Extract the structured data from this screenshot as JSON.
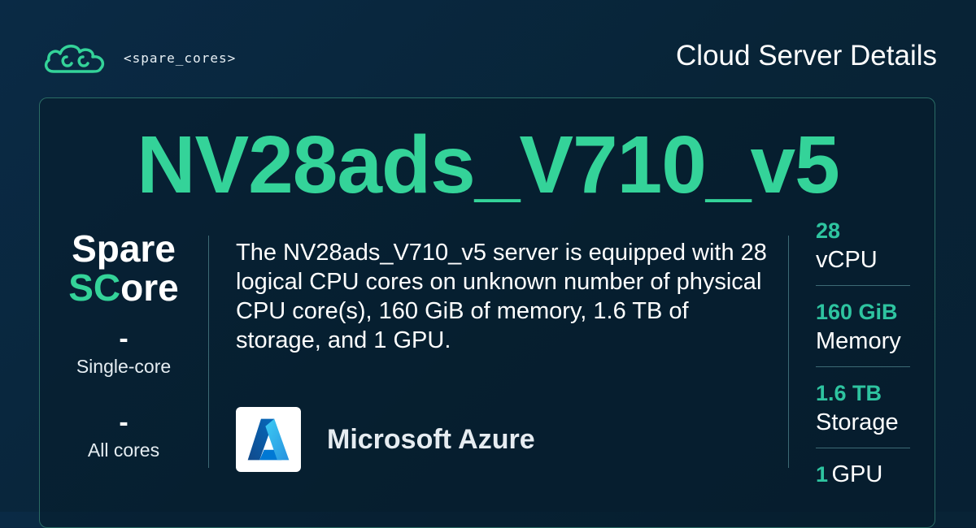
{
  "brand": {
    "name": "<spare_cores>"
  },
  "header": {
    "page_label": "Cloud Server Details"
  },
  "server": {
    "name": "NV28ads_V710_v5"
  },
  "score": {
    "title_line1": "Spare",
    "title_accent": "SC",
    "title_rest": "ore",
    "single_core_value": "-",
    "single_core_label": "Single-core",
    "all_cores_value": "-",
    "all_cores_label": "All cores"
  },
  "description": "The NV28ads_V710_v5 server is equipped with 28 logical CPU cores on unknown number of physical CPU core(s), 160 GiB of memory, 1.6 TB of storage, and 1 GPU.",
  "provider": {
    "name": "Microsoft Azure",
    "logo_icon": "azure-logo-icon"
  },
  "specs": [
    {
      "value": "28",
      "label": "vCPU"
    },
    {
      "value": "160 GiB",
      "label": "Memory"
    },
    {
      "value": "1.6 TB",
      "label": "Storage"
    },
    {
      "value": "1",
      "label": "GPU"
    }
  ],
  "colors": {
    "accent": "#34d399",
    "background": "#0a2a45",
    "spec_value": "#2ec4a0"
  }
}
